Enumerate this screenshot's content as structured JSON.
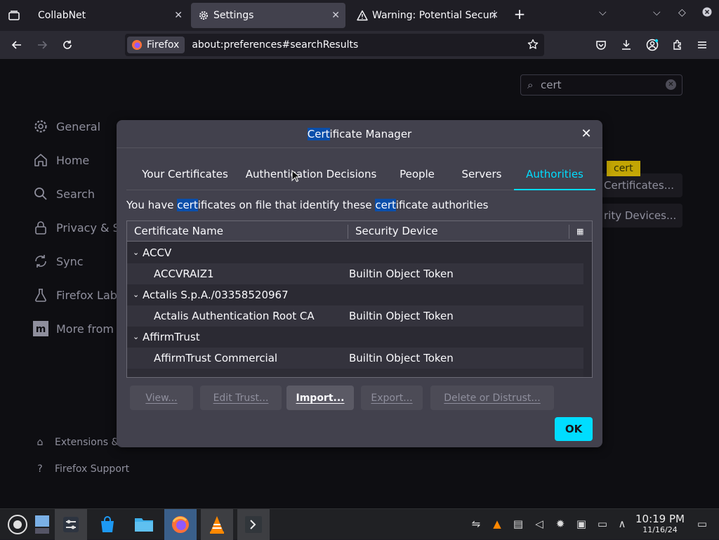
{
  "browser": {
    "tabs": [
      {
        "title": "CollabNet"
      },
      {
        "title": "Settings"
      },
      {
        "title": "Warning: Potential Securi"
      }
    ],
    "identity_label": "Firefox",
    "url": "about:preferences#searchResults"
  },
  "settings": {
    "search_value": "cert",
    "categories": [
      {
        "label": "General",
        "icon": "gear-icon"
      },
      {
        "label": "Home",
        "icon": "home-icon"
      },
      {
        "label": "Search",
        "icon": "search-icon"
      },
      {
        "label": "Privacy & Se",
        "icon": "lock-icon"
      },
      {
        "label": "Sync",
        "icon": "sync-icon"
      },
      {
        "label": "Firefox Labs",
        "icon": "flask-icon"
      },
      {
        "label": "More from M",
        "icon": "mozilla-icon"
      }
    ],
    "footer_links": [
      {
        "label": "Extensions & T"
      },
      {
        "label": "Firefox Support"
      }
    ],
    "view_certificates_label": "Certificates...",
    "security_devices_label": "rity Devices...",
    "highlight_tooltip": "cert"
  },
  "dialog": {
    "title_highlight": "Cert",
    "title_rest": "ificate Manager",
    "tabs": [
      "Your Certificates",
      "Authentication Decisions",
      "People",
      "Servers",
      "Authorities"
    ],
    "selected_tab": "Authorities",
    "description": {
      "p1": "You have ",
      "h1": "cert",
      "p2": "ificates on file that identify these ",
      "h2": "cert",
      "p3": "ificate authorities"
    },
    "columns": [
      "Certificate Name",
      "Security Device"
    ],
    "rows": [
      {
        "type": "group",
        "name": "ACCV"
      },
      {
        "type": "cert",
        "name": "ACCVRAIZ1",
        "device": "Builtin Object Token"
      },
      {
        "type": "group",
        "name": "Actalis S.p.A./03358520967"
      },
      {
        "type": "cert",
        "name": "Actalis Authentication Root CA",
        "device": "Builtin Object Token"
      },
      {
        "type": "group",
        "name": "AffirmTrust"
      },
      {
        "type": "cert",
        "name": "AffirmTrust Commercial",
        "device": "Builtin Object Token"
      }
    ],
    "buttons": {
      "view": "View...",
      "edit_trust": "Edit Trust...",
      "import": "Import...",
      "export": "Export...",
      "delete": "Delete or Distrust...",
      "ok": "OK"
    }
  },
  "taskbar": {
    "time": "10:19 PM",
    "date": "11/16/24"
  },
  "colors": {
    "accent": "#00ddff",
    "highlight": "#0a4eaa",
    "dialog_bg": "#42414d"
  }
}
